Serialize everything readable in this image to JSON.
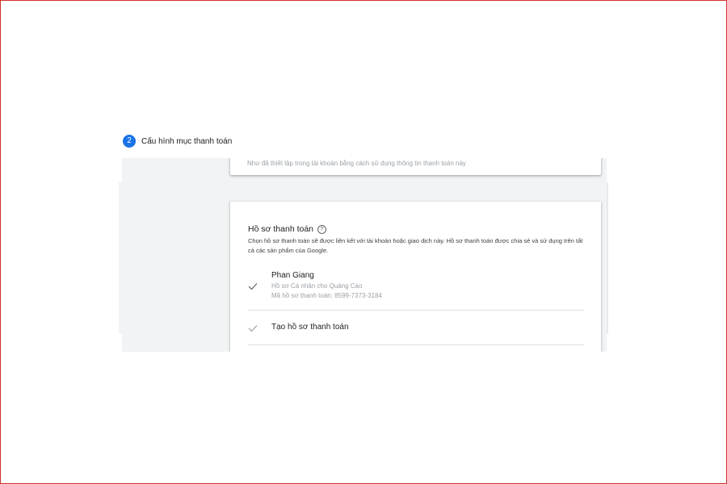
{
  "step": {
    "number": "2",
    "title": "Cấu hình mục thanh toán"
  },
  "top_card": {
    "text": "Như đã thiết lập trong tài khoản bằng cách sử dụng thông tin thanh toán này"
  },
  "payment_profile": {
    "title": "Hồ sơ thanh toán",
    "help_icon": "help-circle-icon",
    "description": "Chọn hồ sơ thanh toán sẽ được liên kết với tài khoản hoặc giao dịch này. Hồ sơ thanh toán được chia sẻ và sử dụng trên tất cả các sản phẩm của Google.",
    "selected_profile": {
      "name": "Phan Giang",
      "type": "Hồ sơ Cá nhân cho Quảng Cáo",
      "id_line": "Mã hồ sơ thanh toán: 8599-7373-3184",
      "icon": "check-icon"
    },
    "create_option": {
      "label": "Tạo hồ sơ thanh toán",
      "icon": "check-icon"
    }
  },
  "colors": {
    "accent": "#1a73e8",
    "frame_border": "#d0342c",
    "panel_bg": "#f1f3f4"
  }
}
